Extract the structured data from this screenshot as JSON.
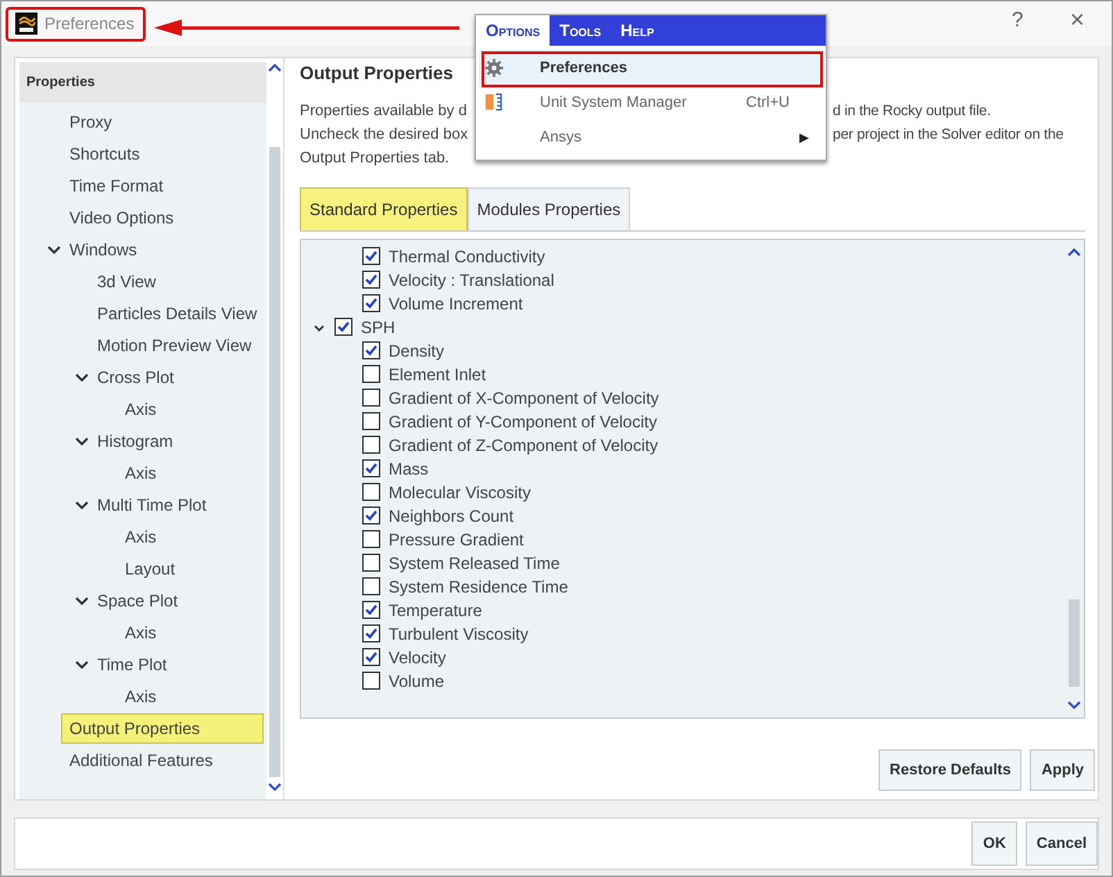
{
  "window": {
    "title": "Preferences",
    "help_button": "?",
    "close_button": "×"
  },
  "sidebar": {
    "header": "Properties",
    "items": [
      {
        "label": "Proxy",
        "selected": false
      },
      {
        "label": "Shortcuts",
        "selected": false
      },
      {
        "label": "Time Format",
        "selected": false
      },
      {
        "label": "Video Options",
        "selected": false
      },
      {
        "label": "Windows",
        "selected": false,
        "expanded": true,
        "children": [
          {
            "label": "3d View",
            "selected": false
          },
          {
            "label": "Particles Details View",
            "selected": false
          },
          {
            "label": "Motion Preview View",
            "selected": false
          },
          {
            "label": "Cross Plot",
            "selected": false,
            "expanded": true,
            "children": [
              {
                "label": "Axis",
                "selected": false
              }
            ]
          },
          {
            "label": "Histogram",
            "selected": false,
            "expanded": true,
            "children": [
              {
                "label": "Axis",
                "selected": false
              }
            ]
          },
          {
            "label": "Multi Time Plot",
            "selected": false,
            "expanded": true,
            "children": [
              {
                "label": "Axis",
                "selected": false
              },
              {
                "label": "Layout",
                "selected": false
              }
            ]
          },
          {
            "label": "Space Plot",
            "selected": false,
            "expanded": true,
            "children": [
              {
                "label": "Axis",
                "selected": false
              }
            ]
          },
          {
            "label": "Time Plot",
            "selected": false,
            "expanded": true,
            "children": [
              {
                "label": "Axis",
                "selected": false
              }
            ]
          }
        ]
      },
      {
        "label": "Output Properties",
        "selected": true
      },
      {
        "label": "Additional Features",
        "selected": false
      }
    ]
  },
  "content": {
    "title": "Output Properties",
    "description_lines": [
      {
        "left": "Properties available by d",
        "right": "d in the Rocky output file."
      },
      {
        "left": "Uncheck the desired box",
        "right": "per project in the Solver editor on the"
      },
      {
        "left": "Output Properties tab."
      }
    ],
    "tabs": [
      {
        "label": "Standard Properties",
        "selected": true
      },
      {
        "label": "Modules Properties",
        "selected": false
      }
    ],
    "continued_items": [
      {
        "label": "Thermal Conductivity",
        "checked": true
      },
      {
        "label": "Velocity : Translational",
        "checked": true
      },
      {
        "label": "Volume Increment",
        "checked": true
      }
    ],
    "groups": [
      {
        "label": "SPH",
        "checked": true,
        "expanded": true,
        "children": [
          {
            "label": "Density",
            "checked": true
          },
          {
            "label": "Element Inlet",
            "checked": false
          },
          {
            "label": "Gradient of X-Component of Velocity",
            "checked": false
          },
          {
            "label": "Gradient of Y-Component of Velocity",
            "checked": false
          },
          {
            "label": "Gradient of Z-Component of Velocity",
            "checked": false
          },
          {
            "label": "Mass",
            "checked": true
          },
          {
            "label": "Molecular Viscosity",
            "checked": false
          },
          {
            "label": "Neighbors Count",
            "checked": true
          },
          {
            "label": "Pressure Gradient",
            "checked": false
          },
          {
            "label": "System Released Time",
            "checked": false
          },
          {
            "label": "System Residence Time",
            "checked": false
          },
          {
            "label": "Temperature",
            "checked": true
          },
          {
            "label": "Turbulent Viscosity",
            "checked": true
          },
          {
            "label": "Velocity",
            "checked": true
          },
          {
            "label": "Volume",
            "checked": false
          }
        ]
      }
    ],
    "buttons": [
      "Restore Defaults",
      "Apply"
    ]
  },
  "footer_buttons": [
    "OK",
    "Cancel"
  ],
  "menu": {
    "bar": [
      {
        "label": "Options",
        "selected": true
      },
      {
        "label": "Tools",
        "selected": false
      },
      {
        "label": "Help",
        "selected": false
      }
    ],
    "items": [
      {
        "label": "Preferences",
        "kind": "gear",
        "highlighted": true
      },
      {
        "label": "Unit System Manager",
        "kind": "ruler",
        "highlighted": false,
        "shortcut": "Ctrl+U"
      },
      {
        "label": "Ansys",
        "kind": "submenu",
        "highlighted": false,
        "shortcut": "▶"
      }
    ]
  }
}
